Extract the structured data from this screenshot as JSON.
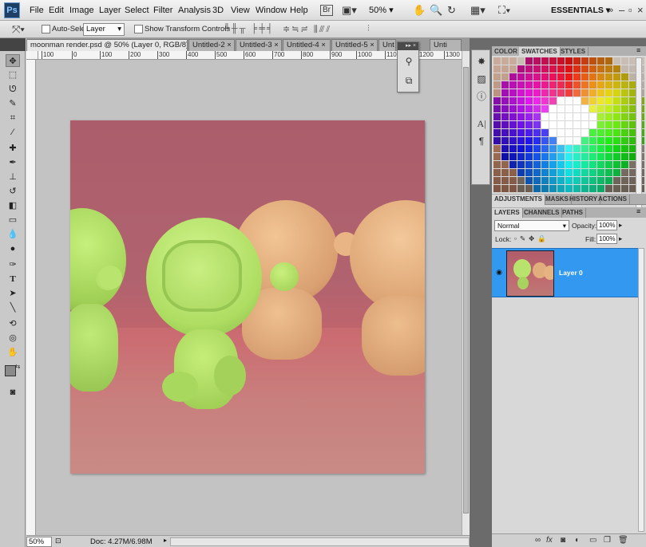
{
  "menubar": {
    "logo": "Ps",
    "items": [
      "File",
      "Edit",
      "Image",
      "Layer",
      "Select",
      "Filter",
      "Analysis",
      "3D",
      "View",
      "Window",
      "Help"
    ],
    "zoom": "50%",
    "workspace": "ESSENTIALS"
  },
  "options": {
    "auto_select_label": "Auto-Select:",
    "layer_value": "Layer",
    "show_transform_label": "Show Transform Controls"
  },
  "tabs": [
    {
      "label": "moonman render.psd @ 50% (Layer 0, RGB/8) *"
    },
    {
      "label": "Untitled-2"
    },
    {
      "label": "Untitled-3"
    },
    {
      "label": "Untitled-4"
    },
    {
      "label": "Untitled-5"
    },
    {
      "label": "Unt"
    },
    {
      "label": "Unti"
    }
  ],
  "ruler": {
    "h_ticks": [
      "100",
      "0",
      "100",
      "200",
      "300",
      "400",
      "500",
      "600",
      "700",
      "800",
      "900",
      "1000",
      "1100",
      "1200",
      "1300"
    ]
  },
  "status": {
    "zoom": "50%",
    "doc_size": "Doc: 4.27M/6.98M"
  },
  "swatch_panel": {
    "tabs": [
      "COLOR",
      "SWATCHES",
      "STYLES"
    ]
  },
  "adjust_panel": {
    "tabs": [
      "ADJUSTMENTS",
      "MASKS",
      "HISTORY",
      "ACTIONS"
    ]
  },
  "layers_panel": {
    "tabs": [
      "LAYERS",
      "CHANNELS",
      "PATHS"
    ],
    "blend_mode": "Normal",
    "opacity_label": "Opacity:",
    "opacity_value": "100%",
    "lock_label": "Lock:",
    "fill_label": "Fill:",
    "fill_value": "100%",
    "layer_name": "Layer 0"
  },
  "colors": {
    "active_layer": "#3298f0",
    "figure_green": "#b6e86c",
    "figure_tan": "#e6b080"
  }
}
